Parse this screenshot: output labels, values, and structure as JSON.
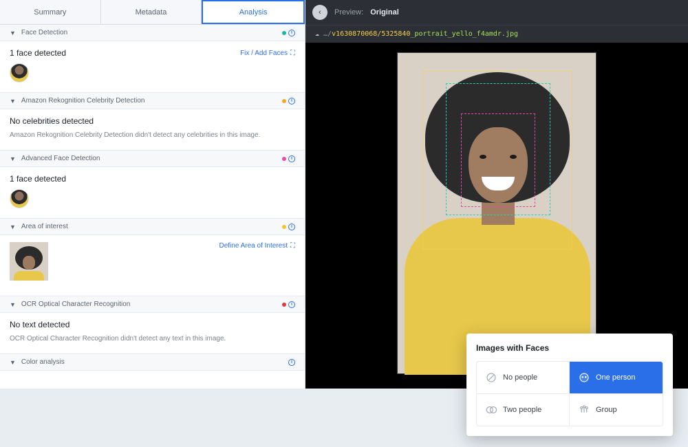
{
  "tabs": {
    "summary": "Summary",
    "metadata": "Metadata",
    "analysis": "Analysis"
  },
  "sections": {
    "face": {
      "title": "Face Detection",
      "result": "1 face detected",
      "action": "Fix / Add Faces"
    },
    "celebrity": {
      "title": "Amazon Rekognition Celebrity Detection",
      "result": "No celebrities detected",
      "sub": "Amazon Rekognition Celebrity Detection didn't detect any celebrities in this image."
    },
    "advface": {
      "title": "Advanced Face Detection",
      "result": "1 face detected"
    },
    "aoi": {
      "title": "Area of interest",
      "action": "Define Area of Interest"
    },
    "ocr": {
      "title": "OCR Optical Character Recognition",
      "result": "No text detected",
      "sub": "OCR Optical Character Recognition didn't detect any text in this image."
    },
    "color": {
      "title": "Color analysis"
    }
  },
  "preview": {
    "label": "Preview:",
    "mode": "Original",
    "path_prefix": "…/",
    "path_yellow": "v1630870068/5325840",
    "path_green": "_portrait_yello_f4amdr.jpg"
  },
  "card": {
    "title": "Images with Faces",
    "opts": {
      "none": "No people",
      "one": "One person",
      "two": "Two people",
      "group": "Group"
    }
  }
}
